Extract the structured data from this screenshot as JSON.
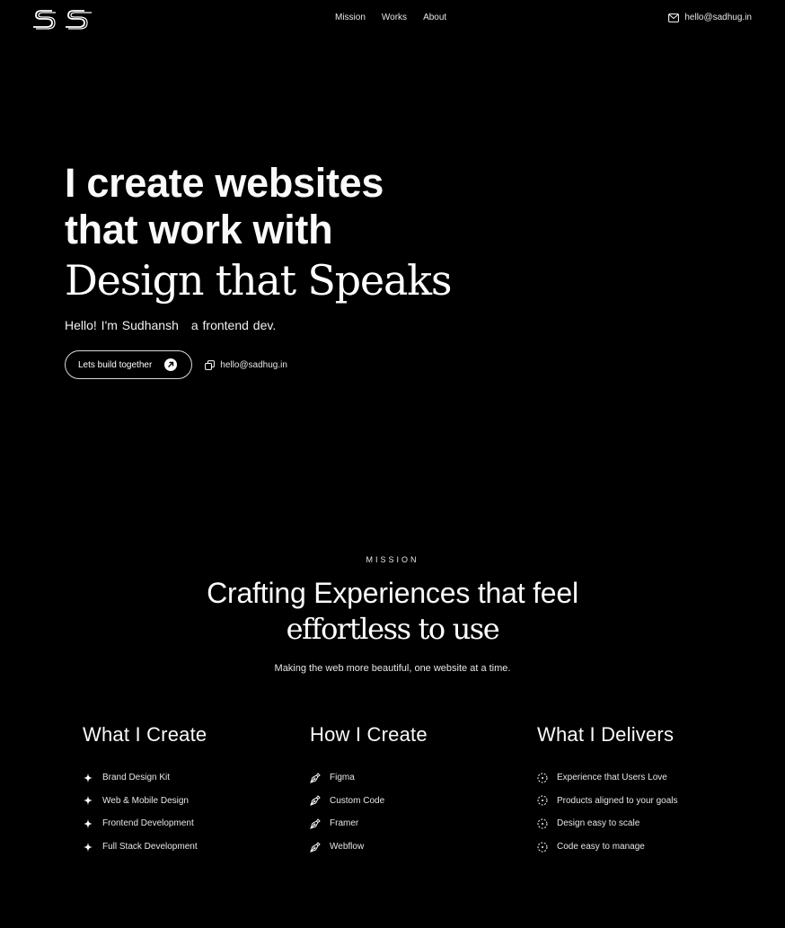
{
  "nav": {
    "logo_text": "SS",
    "links": [
      "Mission",
      "Works",
      "About"
    ],
    "email": "hello@sadhug.in"
  },
  "hero": {
    "line1": "I create websites",
    "line2": "that work with",
    "line3": "Design that Speaks",
    "intro_part1": "Hello! I'm Sudhansh",
    "intro_part2": "a frontend dev.",
    "cta_label": "Lets build together",
    "copy_email": "hello@sadhug.in"
  },
  "mission": {
    "eyebrow": "MISSION",
    "headline": "Crafting Experiences that feel",
    "headline_serif": "effortless to use",
    "subtitle": "Making the web more beautiful, one website at a time."
  },
  "columns": [
    {
      "title": "What I Create",
      "icon": "sparkle-icon",
      "items": [
        "Brand Design Kit",
        "Web & Mobile Design",
        "Frontend Development",
        "Full Stack Development"
      ]
    },
    {
      "title": "How I Create",
      "icon": "pen-tool-icon",
      "items": [
        "Figma",
        "Custom Code",
        "Framer",
        "Webflow"
      ]
    },
    {
      "title": "What I Delivers",
      "icon": "dashed-circle-icon",
      "items": [
        "Experience that Users Love",
        "Products aligned to your goals",
        "Design easy to scale",
        "Code easy to manage"
      ]
    }
  ],
  "colors": {
    "background": "#000000",
    "text": "#ffffff"
  }
}
